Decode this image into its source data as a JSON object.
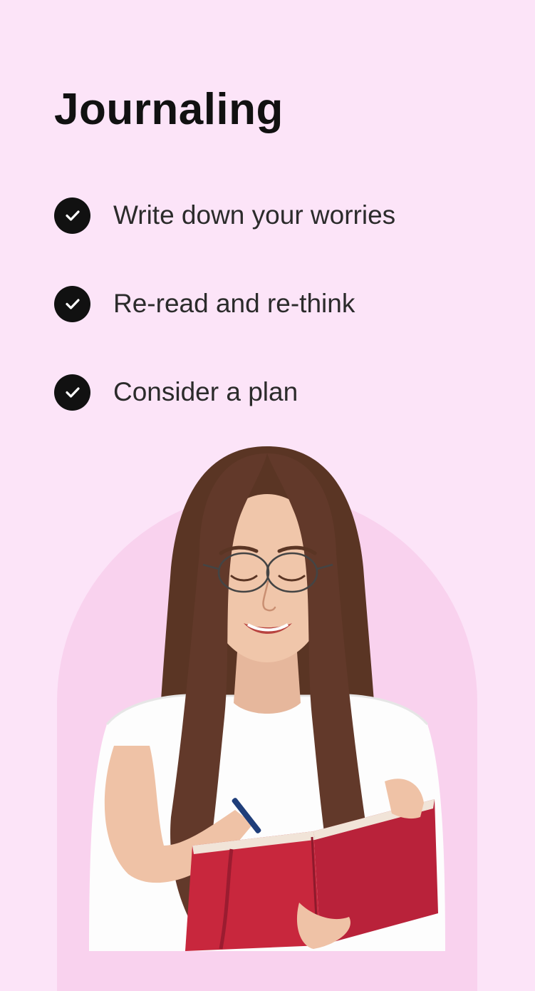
{
  "page": {
    "title": "Journaling",
    "background_color": "#fce4f8",
    "arch_color": "#f9d2ee"
  },
  "checklist": [
    {
      "icon": "check-circle-icon",
      "label": "Write down your worries"
    },
    {
      "icon": "check-circle-icon",
      "label": "Re-read and re-think"
    },
    {
      "icon": "check-circle-icon",
      "label": "Consider a plan"
    }
  ],
  "illustration": {
    "subject": "woman-with-glasses-writing-in-red-notebook"
  }
}
